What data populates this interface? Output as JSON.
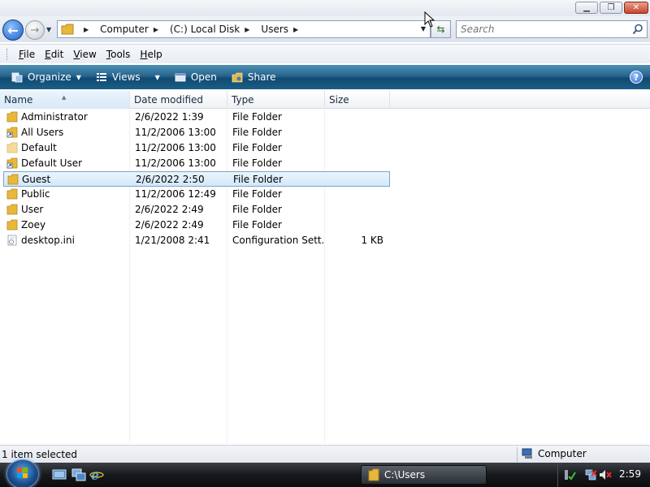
{
  "window": {
    "buttons": {
      "minimize": "▁",
      "maximize": "❐",
      "close": "✕"
    }
  },
  "address": {
    "crumbs": [
      "Computer",
      "(C:) Local Disk",
      "Users"
    ],
    "search_placeholder": "Search"
  },
  "menu": [
    {
      "key": "F",
      "rest": "ile"
    },
    {
      "key": "E",
      "rest": "dit"
    },
    {
      "key": "V",
      "rest": "iew"
    },
    {
      "key": "T",
      "rest": "ools"
    },
    {
      "key": "H",
      "rest": "elp"
    }
  ],
  "commands": {
    "organize": "Organize",
    "views": "Views",
    "open": "Open",
    "share": "Share",
    "help": "?"
  },
  "columns": {
    "name": "Name",
    "date": "Date modified",
    "type": "Type",
    "size": "Size"
  },
  "files": [
    {
      "name": "Administrator",
      "date": "2/6/2022 1:39",
      "type": "File Folder",
      "size": "",
      "icon": "folder-icon",
      "selected": false
    },
    {
      "name": "All Users",
      "date": "11/2/2006 13:00",
      "type": "File Folder",
      "size": "",
      "icon": "shortcut-icon",
      "selected": false
    },
    {
      "name": "Default",
      "date": "11/2/2006 13:00",
      "type": "File Folder",
      "size": "",
      "icon": "folder-hidden-icon",
      "selected": false
    },
    {
      "name": "Default User",
      "date": "11/2/2006 13:00",
      "type": "File Folder",
      "size": "",
      "icon": "shortcut-icon",
      "selected": false
    },
    {
      "name": "Guest",
      "date": "2/6/2022 2:50",
      "type": "File Folder",
      "size": "",
      "icon": "folder-icon",
      "selected": true
    },
    {
      "name": "Public",
      "date": "11/2/2006 12:49",
      "type": "File Folder",
      "size": "",
      "icon": "folder-icon",
      "selected": false
    },
    {
      "name": "User",
      "date": "2/6/2022 2:49",
      "type": "File Folder",
      "size": "",
      "icon": "folder-icon",
      "selected": false
    },
    {
      "name": "Zoey",
      "date": "2/6/2022 2:49",
      "type": "File Folder",
      "size": "",
      "icon": "folder-icon",
      "selected": false
    },
    {
      "name": "desktop.ini",
      "date": "1/21/2008 2:41",
      "type": "Configuration Sett...",
      "size": "1 KB",
      "icon": "ini-file-icon",
      "selected": false
    }
  ],
  "status": {
    "left": "1 item selected",
    "right": "Computer"
  },
  "taskbar": {
    "window_button": "C:\\Users",
    "clock": "2:59"
  },
  "colors": {
    "folder": "#e8b83a",
    "selection": "#d2e8fa",
    "command_bar": "#1b5e86"
  }
}
